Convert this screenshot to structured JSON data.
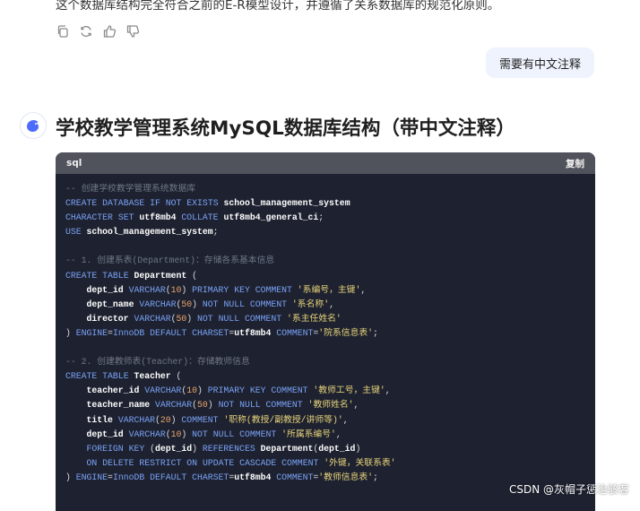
{
  "message": {
    "top_text": "这个数据库结构完全符合之前的E-R模型设计，并遵循了关系数据库的规范化原则。",
    "actions": [
      {
        "name": "copy-icon"
      },
      {
        "name": "regenerate-icon"
      },
      {
        "name": "thumbs-up-icon"
      },
      {
        "name": "thumbs-down-icon"
      }
    ]
  },
  "user_bubble": {
    "text": "需要有中文注释"
  },
  "assistant": {
    "avatar_icon": "assistant-logo-icon"
  },
  "answer": {
    "heading": "学校教学管理系统MySQL数据库结构（带中文注释）",
    "code": {
      "lang": "sql",
      "copy_label": "复制",
      "lines": [
        "-- 创建学校教学管理系统数据库",
        "CREATE DATABASE IF NOT EXISTS school_management_system",
        "CHARACTER SET utf8mb4 COLLATE utf8mb4_general_ci;",
        "USE school_management_system;",
        "",
        "-- 1. 创建系表(Department)：存储各系基本信息",
        "CREATE TABLE Department (",
        "    dept_id VARCHAR(10) PRIMARY KEY COMMENT '系编号，主键',",
        "    dept_name VARCHAR(50) NOT NULL COMMENT '系名称',",
        "    director VARCHAR(50) NOT NULL COMMENT '系主任姓名'",
        ") ENGINE=InnoDB DEFAULT CHARSET=utf8mb4 COMMENT='院系信息表';",
        "",
        "-- 2. 创建教师表(Teacher)：存储教师信息",
        "CREATE TABLE Teacher (",
        "    teacher_id VARCHAR(10) PRIMARY KEY COMMENT '教师工号，主键',",
        "    teacher_name VARCHAR(50) NOT NULL COMMENT '教师姓名',",
        "    title VARCHAR(20) COMMENT '职称(教授/副教授/讲师等)',",
        "    dept_id VARCHAR(10) NOT NULL COMMENT '所属系编号',",
        "    FOREIGN KEY (dept_id) REFERENCES Department(dept_id)",
        "    ON DELETE RESTRICT ON UPDATE CASCADE COMMENT '外键，关联系表'",
        ") ENGINE=InnoDB DEFAULT CHARSET=utf8mb4 COMMENT='教师信息表';"
      ]
    }
  },
  "watermark": "CSDN @灰帽子惩治骇客"
}
